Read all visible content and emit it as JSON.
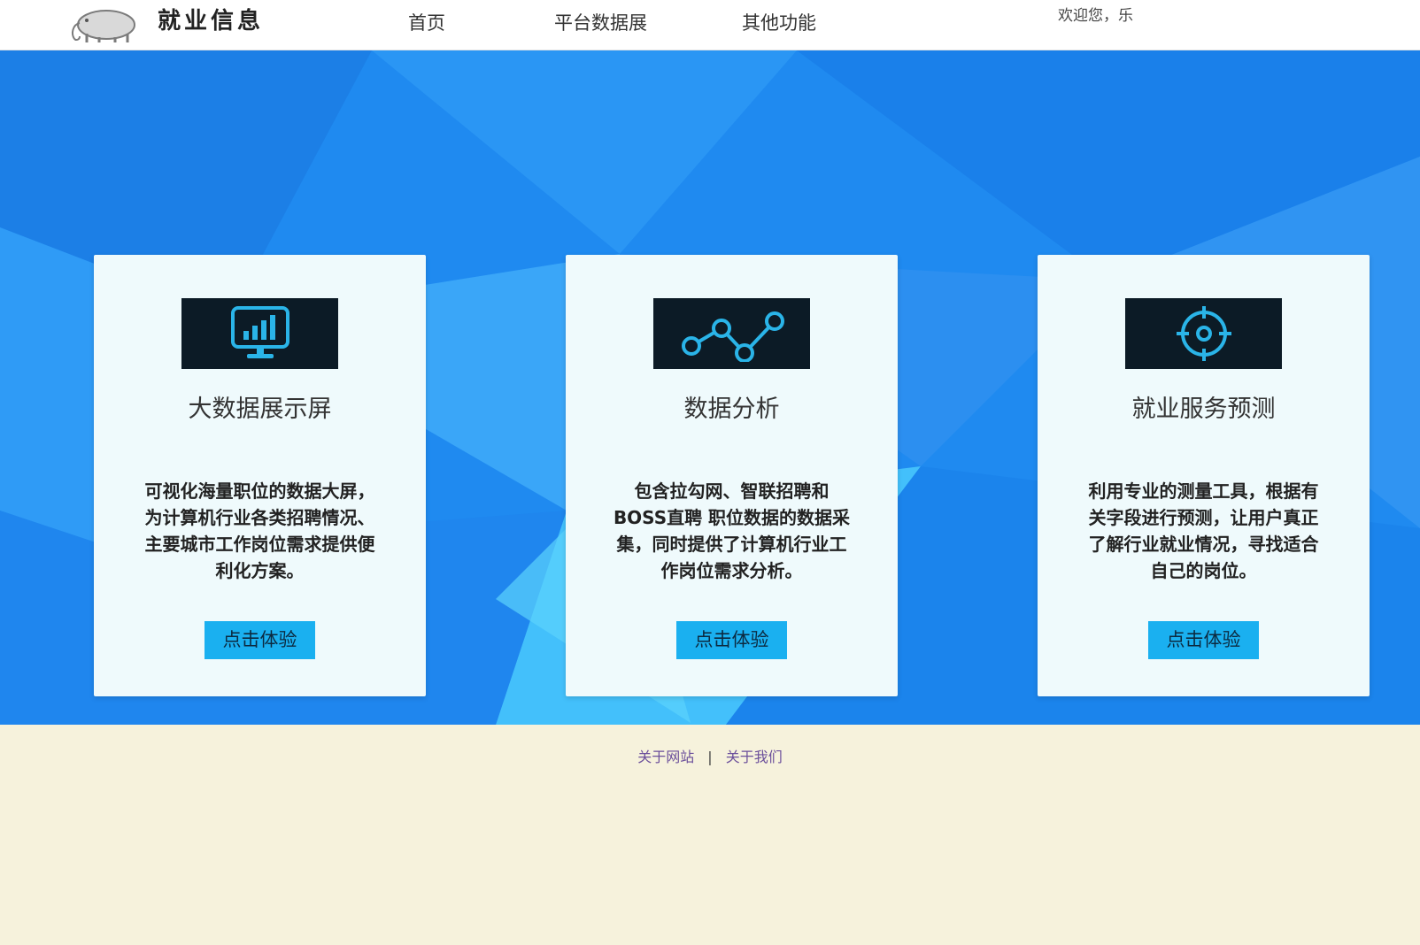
{
  "header": {
    "site_title": "就业信息",
    "logo_icon": "elephant-logo",
    "nav": [
      {
        "label": "首页"
      },
      {
        "label": "平台数据展"
      },
      {
        "label": "其他功能"
      }
    ],
    "welcome_text": "欢迎您，乐"
  },
  "cards": [
    {
      "icon": "monitor-chart-icon",
      "title": "大数据展示屏",
      "desc": "可视化海量职位的数据大屏，为计算机行业各类招聘情况、主要城市工作岗位需求提供便利化方案。",
      "button": "点击体验"
    },
    {
      "icon": "line-chart-icon",
      "title": "数据分析",
      "desc": "包含拉勾网、智联招聘和BOSS直聘 职位数据的数据采集，同时提供了计算机行业工作岗位需求分析。",
      "button": "点击体验"
    },
    {
      "icon": "target-icon",
      "title": "就业服务预测",
      "desc": "利用专业的测量工具，根据有关字段进行预测，让用户真正了解行业就业情况，寻找适合自己的岗位。",
      "button": "点击体验"
    }
  ],
  "footer": {
    "links": [
      {
        "label": "关于网站"
      },
      {
        "label": "关于我们"
      }
    ],
    "separator": "|"
  },
  "colors": {
    "hero_blue": "#1f8af0",
    "card_bg": "#effafc",
    "icon_box": "#0c1b26",
    "icon_stroke": "#2ab4e8",
    "button": "#1ab0f0",
    "footer_bg": "#f6f2dc",
    "footer_link": "#6b4f9b"
  }
}
